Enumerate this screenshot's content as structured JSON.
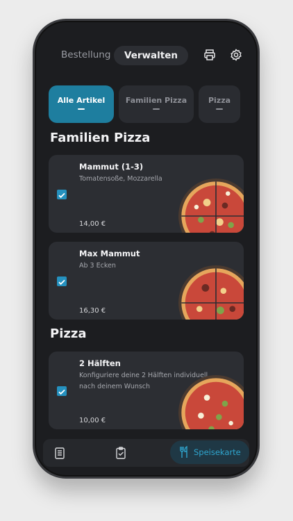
{
  "header": {
    "tab_bestellung": "Bestellung",
    "tab_verwalten": "Verwalten",
    "icons": [
      "printer-icon",
      "gear-icon"
    ]
  },
  "categories": [
    {
      "label": "Alle Artikel",
      "active": true
    },
    {
      "label": "Familien Pizza",
      "active": false
    },
    {
      "label": "Pizza",
      "active": false
    }
  ],
  "sections": [
    {
      "title": "Familien Pizza",
      "items": [
        {
          "name": "Mammut (1-3)",
          "description": "Tomatensoße, Mozzarella",
          "price": "14,00 €",
          "checked": true
        },
        {
          "name": "Max Mammut",
          "description": "Ab 3 Ecken",
          "price": "16,30 €",
          "checked": true
        }
      ]
    },
    {
      "title": "Pizza",
      "items": [
        {
          "name": "2 Hälften",
          "description": "Konfiguriere deine 2 Hälften individuell nach deinem Wunsch",
          "price": "10,00 €",
          "checked": true
        }
      ]
    }
  ],
  "bottom_nav": {
    "speisekarte_label": "Speisekarte",
    "icons": [
      "order-list-icon",
      "clipboard-check-icon",
      "fork-knife-icon"
    ]
  },
  "colors": {
    "accent": "#1e7e9f",
    "background": "#1c1d20",
    "card": "#2c2e33"
  }
}
